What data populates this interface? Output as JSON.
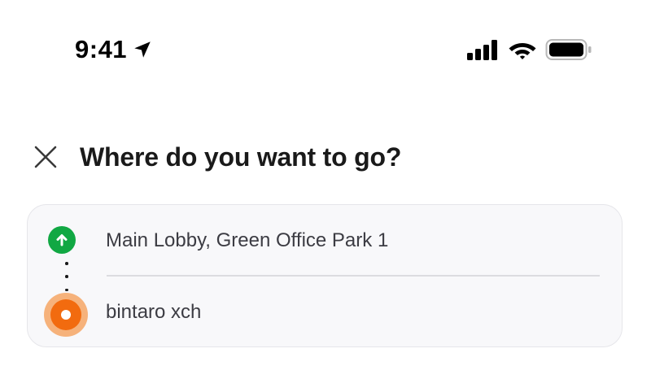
{
  "status_bar": {
    "time": "9:41",
    "location_icon": "location-arrow-icon",
    "signal_icon": "cellular-signal-icon",
    "wifi_icon": "wifi-icon",
    "battery_icon": "battery-icon"
  },
  "header": {
    "close_icon": "close-icon",
    "title": "Where do you want to go?"
  },
  "route": {
    "origin": {
      "label": "Main Lobby, Green Office Park 1",
      "icon": "arrow-up-icon",
      "color": "#11a843"
    },
    "destination": {
      "label": "bintaro xch",
      "icon": "destination-dot-icon",
      "color": "#f26b0f"
    }
  }
}
